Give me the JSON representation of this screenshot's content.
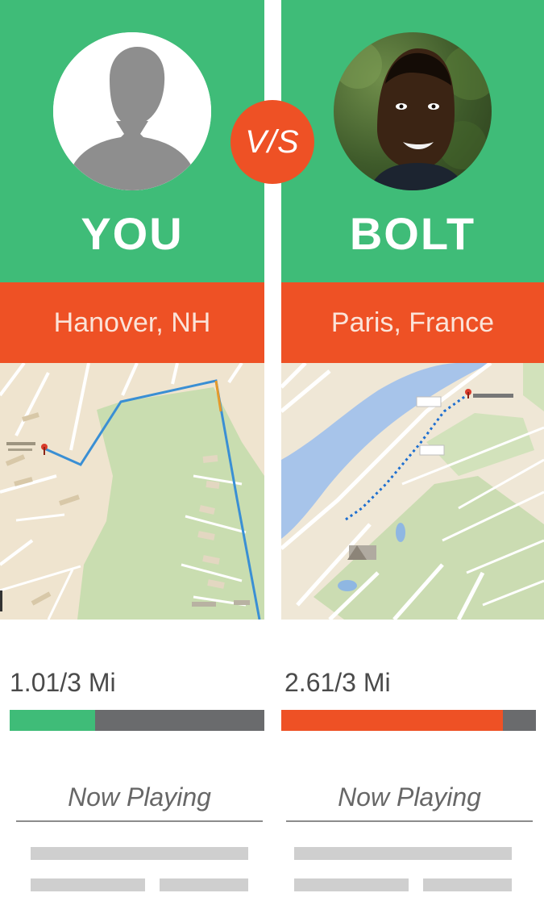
{
  "vs_label": "V/S",
  "players": [
    {
      "name": "YOU",
      "location": "Hanover, NH",
      "distance_text": "1.01/3 Mi",
      "progress_fraction": 0.3367,
      "progress_color": "#3fbc78",
      "now_playing": "Now Playing"
    },
    {
      "name": "BOLT",
      "location": "Paris, France",
      "distance_text": "2.61/3 Mi",
      "progress_fraction": 0.87,
      "progress_color": "#ee5125",
      "now_playing": "Now Playing"
    }
  ],
  "colors": {
    "green": "#3fbc78",
    "orange": "#ee5125",
    "progress_track": "#6a6b6d",
    "placeholder": "#cfcfcf"
  },
  "icons": {
    "left_avatar": "default-user-silhouette",
    "right_avatar": "user-photo",
    "route_marker": "map-pin-icon"
  }
}
